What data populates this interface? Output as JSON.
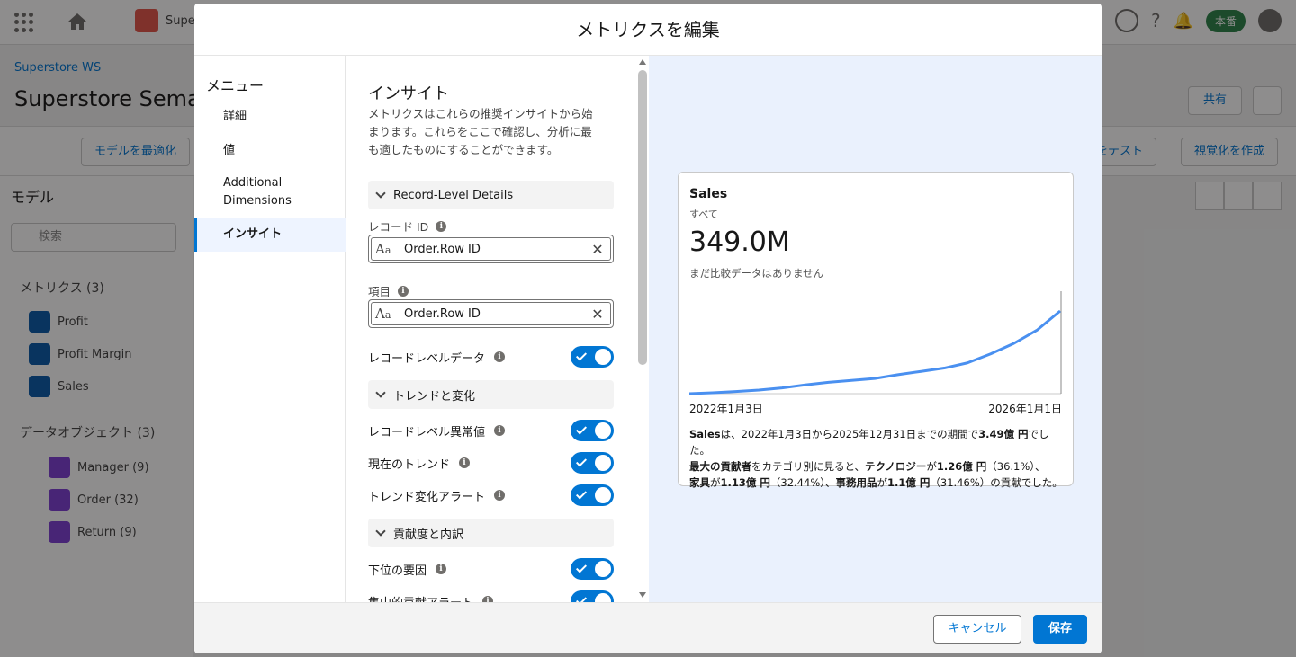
{
  "background": {
    "app_tab_label": "Super",
    "prod_badge": "本番",
    "breadcrumb": "Superstore WS",
    "page_title": "Superstore Semant",
    "share_label": "共有",
    "optimize_label": "モデルを最適化",
    "test_label": "ルをテスト",
    "create_viz_label": "視覚化を作成",
    "model_title": "モデル",
    "search_placeholder": "検索",
    "metrics_section": "メトリクス (3)",
    "metrics": [
      "Profit",
      "Profit Margin",
      "Sales"
    ],
    "objects_section": "データオブジェクト (3)",
    "objects": [
      "Manager (9)",
      "Order (32)",
      "Return (9)"
    ]
  },
  "modal": {
    "title": "メトリクスを編集",
    "menu": {
      "title": "メニュー",
      "items": [
        {
          "label": "詳細",
          "active": false
        },
        {
          "label": "値",
          "active": false
        },
        {
          "label": "Additional Dimensions",
          "active": false
        },
        {
          "label": "インサイト",
          "active": true
        }
      ]
    },
    "insights": {
      "title": "インサイト",
      "description": "メトリクスはこれらの推奨インサイトから始まります。これらをここで確認し、分析に最も適したものにすることができます。",
      "record_section": "Record-Level Details",
      "record_id_label": "レコード ID",
      "record_id_value": "Order.Row ID",
      "field_label": "項目",
      "field_value": "Order.Row ID",
      "record_data_label": "レコードレベルデータ",
      "trend_section": "トレンドと変化",
      "outliers_label": "レコードレベル異常値",
      "current_trend_label": "現在のトレンド",
      "trend_alert_label": "トレンド変化アラート",
      "contrib_section": "貢献度と内訳",
      "bottom_drivers_label": "下位の要因",
      "concentration_label": "集中的貢献アラート"
    },
    "preview": {
      "title": "Sales",
      "subtitle": "すべて",
      "value": "349.0M",
      "note": "まだ比較データはありません",
      "x_start": "2022年1月3日",
      "x_end": "2026年1月1日",
      "summary": {
        "s1": "Sales",
        "s2": "は、2022年1月3日から2025年12月31日までの期間で",
        "s3": "3.49億 円",
        "s4": "でした。",
        "s5": "最大の貢献者",
        "s6": "をカテゴリ別に見ると、",
        "s7": "テクノロジー",
        "s8": "が",
        "s9": "1.26億 円",
        "s10": "（36.1%）、",
        "s11": "家具",
        "s12": "が",
        "s13": "1.13億 円",
        "s14": "（32.44%）、",
        "s15": "事務用品",
        "s16": "が",
        "s17": "1.1億 円",
        "s18": "（31.46%）の貢献でした。"
      }
    },
    "footer": {
      "cancel_label": "キャンセル",
      "save_label": "保存"
    }
  },
  "chart_data": {
    "type": "line",
    "title": "Sales",
    "x": [
      "2022-01-03",
      "2022-04",
      "2022-07",
      "2022-10",
      "2023-01",
      "2023-04",
      "2023-07",
      "2023-10",
      "2024-01",
      "2024-04",
      "2024-07",
      "2024-10",
      "2025-01",
      "2025-04",
      "2025-07",
      "2025-10",
      "2025-12-31"
    ],
    "series": [
      {
        "values": [
          0,
          4,
          9,
          15,
          24,
          37,
          48,
          56,
          64,
          80,
          94,
          108,
          130,
          168,
          212,
          268,
          349
        ]
      }
    ],
    "x_tick_labels": [
      "2022年1月3日",
      "2026年1月1日"
    ],
    "color": "#4a90f0",
    "grid": false
  },
  "colors": {
    "brand": "#0176d3",
    "preview_bg": "#eaf1fd",
    "line": "#4a90f0"
  }
}
